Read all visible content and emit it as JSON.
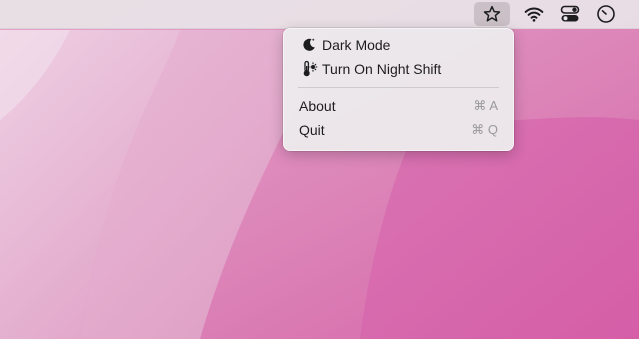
{
  "menubar": {
    "items": [
      {
        "icon": "star-icon",
        "active": true
      },
      {
        "icon": "wifi-icon"
      },
      {
        "icon": "control-center-icon"
      },
      {
        "icon": "clock-icon"
      }
    ]
  },
  "menu": {
    "dark_mode": {
      "label": "Dark Mode",
      "icon": "moon-icon"
    },
    "night_shift": {
      "label": "Turn On Night Shift",
      "icon": "thermometer-sun-icon"
    },
    "about": {
      "label": "About",
      "shortcut": "⌘ A"
    },
    "quit": {
      "label": "Quit",
      "shortcut": "⌘ Q"
    }
  },
  "colors": {
    "wallpaper_base": "#dd7fb4",
    "wallpaper_light": "#e6b0cf",
    "menu_bg": "#eceaec",
    "text": "#1d1d1f",
    "shortcut_text": "#9a9a9c"
  }
}
